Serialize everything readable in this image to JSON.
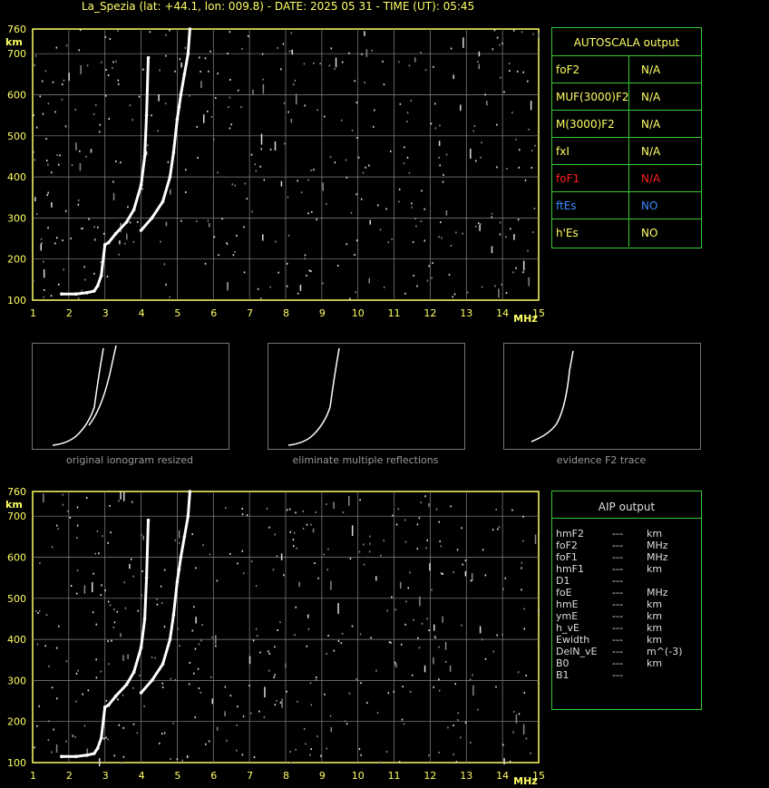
{
  "title": "La_Spezia (lat: +44.1, lon: 009.8) - DATE: 2025 05 31 - TIME (UT): 05:45",
  "colors": {
    "axis": "#ffff66",
    "grid": "#888888",
    "trace": "#ffffff",
    "table_border": "#33cc33",
    "fof1_red": "#ff2020",
    "es_blue": "#3b8cff"
  },
  "chart_data": [
    {
      "type": "scatter",
      "name_panel": "top ionogram",
      "xlabel": "MHz",
      "ylabel": "km",
      "xlim": [
        1,
        15
      ],
      "ylim": [
        100,
        760
      ],
      "x_ticks": [
        "1",
        "2",
        "3",
        "4",
        "5",
        "6",
        "7",
        "8",
        "9",
        "10",
        "11",
        "12",
        "13",
        "14",
        "15"
      ],
      "y_ticks": [
        "100",
        "200",
        "300",
        "400",
        "500",
        "600",
        "700",
        "760"
      ],
      "series": [
        {
          "x": [
            1.8,
            2.2,
            2.5,
            2.7,
            2.8,
            2.9,
            3.0,
            3.1,
            3.3,
            3.6,
            3.8,
            4.0,
            4.1,
            4.15,
            4.2
          ],
          "y": [
            115,
            115,
            118,
            122,
            135,
            160,
            235,
            240,
            262,
            290,
            320,
            380,
            450,
            550,
            690
          ]
        },
        {
          "x": [
            4.0,
            4.3,
            4.6,
            4.8,
            4.9,
            5.0,
            5.05,
            5.1,
            5.2,
            5.3,
            5.35
          ],
          "y": [
            270,
            300,
            340,
            400,
            460,
            540,
            570,
            600,
            650,
            700,
            760
          ]
        }
      ]
    },
    {
      "type": "scatter",
      "name_panel": "bottom ionogram",
      "xlabel": "MHz",
      "ylabel": "km",
      "xlim": [
        1,
        15
      ],
      "ylim": [
        100,
        760
      ],
      "x_ticks": [
        "1",
        "2",
        "3",
        "4",
        "5",
        "6",
        "7",
        "8",
        "9",
        "10",
        "11",
        "12",
        "13",
        "14",
        "15"
      ],
      "y_ticks": [
        "100",
        "200",
        "300",
        "400",
        "500",
        "600",
        "700",
        "760"
      ],
      "series": [
        {
          "x": [
            1.8,
            2.2,
            2.5,
            2.7,
            2.8,
            2.9,
            3.0,
            3.1,
            3.3,
            3.6,
            3.8,
            4.0,
            4.1,
            4.15,
            4.2
          ],
          "y": [
            115,
            115,
            118,
            122,
            135,
            160,
            235,
            240,
            262,
            290,
            320,
            380,
            450,
            550,
            690
          ]
        },
        {
          "x": [
            4.0,
            4.3,
            4.6,
            4.8,
            4.9,
            5.0,
            5.05,
            5.1,
            5.2,
            5.3,
            5.35
          ],
          "y": [
            270,
            300,
            340,
            400,
            460,
            540,
            570,
            600,
            650,
            700,
            760
          ]
        }
      ]
    }
  ],
  "thumbnails": [
    {
      "caption": "original ionogram resized"
    },
    {
      "caption": "eliminate multiple reflections"
    },
    {
      "caption": "evidence F2 trace"
    }
  ],
  "autoscala": {
    "header": "AUTOSCALA output",
    "rows": [
      {
        "name": "foF2",
        "value": "N/A",
        "color": "#ffff66"
      },
      {
        "name": "MUF(3000)F2",
        "value": "N/A",
        "color": "#ffff66"
      },
      {
        "name": "M(3000)F2",
        "value": "N/A",
        "color": "#ffff66"
      },
      {
        "name": "fxI",
        "value": "N/A",
        "color": "#ffff66"
      },
      {
        "name": "foF1",
        "value": "N/A",
        "color": "#ff2020"
      },
      {
        "name": "ftEs",
        "value": "NO",
        "color": "#3b8cff"
      },
      {
        "name": "h'Es",
        "value": "NO",
        "color": "#ffff66"
      }
    ]
  },
  "aip": {
    "header": "AIP output",
    "rows": [
      {
        "name": "hmF2",
        "value": "---",
        "unit": "km"
      },
      {
        "name": "foF2",
        "value": "---",
        "unit": "MHz"
      },
      {
        "name": "foF1",
        "value": "---",
        "unit": "MHz"
      },
      {
        "name": "hmF1",
        "value": "---",
        "unit": "km"
      },
      {
        "name": "D1",
        "value": "---",
        "unit": ""
      },
      {
        "name": "foE",
        "value": "---",
        "unit": "MHz"
      },
      {
        "name": "hmE",
        "value": "---",
        "unit": "km"
      },
      {
        "name": "ymE",
        "value": "---",
        "unit": "km"
      },
      {
        "name": "h_vE",
        "value": "---",
        "unit": "km"
      },
      {
        "name": "Ewidth",
        "value": "---",
        "unit": "km"
      },
      {
        "name": "DelN_vE",
        "value": "---",
        "unit": "m^(-3)"
      },
      {
        "name": "B0",
        "value": "---",
        "unit": "km"
      },
      {
        "name": "B1",
        "value": "---",
        "unit": ""
      }
    ]
  }
}
